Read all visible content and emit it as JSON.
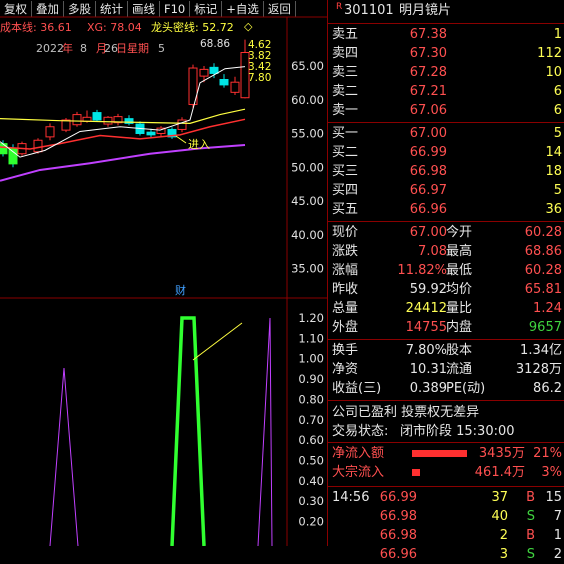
{
  "toolbar": {
    "items": [
      "复权",
      "叠加",
      "多股",
      "统计",
      "画线",
      "F10",
      "标记",
      "+自选",
      "返回"
    ]
  },
  "chart": {
    "indicator_cost": "成本线: 36.61",
    "indicator_xg": "XG: 78.04",
    "indicator_dragon": "龙头密线: 52.72",
    "date_text": "2022年 8 月 26日星期 5",
    "date_parts": [
      "2022",
      "年",
      "8",
      "月",
      "26",
      "日星期",
      "5"
    ],
    "y_axis": [
      "65.00",
      "60.00",
      "55.00",
      "50.00",
      "45.00",
      "40.00",
      "35.00"
    ],
    "price_labels": [
      "68.86",
      "4.62",
      "3.82",
      "3.42",
      "7.80"
    ],
    "signal_label": "进入",
    "finance_marker": "财",
    "lower_axis": [
      "1.20",
      "1.10",
      "1.00",
      "0.90",
      "0.80",
      "0.70",
      "0.60",
      "0.50",
      "0.40",
      "0.30",
      "0.20"
    ],
    "colors": {
      "up": "#ff3030",
      "down": "#00e5e5",
      "yellow": "#ffff40",
      "purple": "#c040ff",
      "green": "#30ff30",
      "grid": "#8a0000"
    }
  },
  "quote": {
    "badge": "R",
    "code": "301101",
    "name": "明月镜片",
    "sell": [
      {
        "label": "卖五",
        "price": "67.38",
        "vol": "1"
      },
      {
        "label": "卖四",
        "price": "67.30",
        "vol": "112"
      },
      {
        "label": "卖三",
        "price": "67.28",
        "vol": "10"
      },
      {
        "label": "卖二",
        "price": "67.21",
        "vol": "6"
      },
      {
        "label": "卖一",
        "price": "67.06",
        "vol": "6"
      }
    ],
    "buy": [
      {
        "label": "买一",
        "price": "67.00",
        "vol": "5"
      },
      {
        "label": "买二",
        "price": "66.99",
        "vol": "14"
      },
      {
        "label": "买三",
        "price": "66.98",
        "vol": "18"
      },
      {
        "label": "买四",
        "price": "66.97",
        "vol": "5"
      },
      {
        "label": "买五",
        "price": "66.96",
        "vol": "36"
      }
    ],
    "stats": [
      {
        "l1": "现价",
        "v1": "67.00",
        "l2": "今开",
        "v2": "60.28"
      },
      {
        "l1": "涨跌",
        "v1": "7.08",
        "l2": "最高",
        "v2": "68.86"
      },
      {
        "l1": "涨幅",
        "v1": "11.82%",
        "l2": "最低",
        "v2": "60.28"
      },
      {
        "l1": "昨收",
        "v1": "59.92",
        "l2": "均价",
        "v2": "65.81"
      },
      {
        "l1": "总量",
        "v1": "24412",
        "l2": "量比",
        "v2": "1.24"
      },
      {
        "l1": "外盘",
        "v1": "14755",
        "l2": "内盘",
        "v2": "9657"
      }
    ],
    "stats2": [
      {
        "l1": "换手",
        "v1": "7.80%",
        "l2": "股本",
        "v2": "1.34亿"
      },
      {
        "l1": "净资",
        "v1": "10.31",
        "l2": "流通",
        "v2": "3128万"
      },
      {
        "l1": "收益(三)",
        "v1": "0.389",
        "l2": "PE(动)",
        "v2": "86.2"
      }
    ],
    "company_note": "公司已盈利 投票权无差异",
    "trade_status_label": "交易状态:",
    "trade_status_value": "闭市阶段 15:30:00",
    "flow": [
      {
        "label": "净流入额",
        "amount": "3435万",
        "pct": "21%",
        "bar": 0.21
      },
      {
        "label": "大宗流入",
        "amount": "461.4万",
        "pct": "3%",
        "bar": 0.03
      }
    ],
    "ticks": [
      {
        "time": "14:56",
        "price": "66.99",
        "vol": "37",
        "side": "B",
        "count": "15"
      },
      {
        "time": "",
        "price": "66.98",
        "vol": "40",
        "side": "S",
        "count": "7"
      },
      {
        "time": "",
        "price": "66.98",
        "vol": "2",
        "side": "B",
        "count": "1"
      },
      {
        "time": "",
        "price": "66.96",
        "vol": "3",
        "side": "S",
        "count": "2"
      }
    ]
  }
}
